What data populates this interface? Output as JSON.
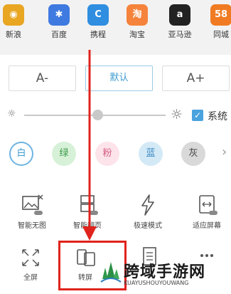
{
  "apps": [
    {
      "label": "新浪",
      "icon": "sina-icon",
      "glyph": "◉",
      "color": "#e8a623"
    },
    {
      "label": "百度",
      "icon": "baidu-icon",
      "glyph": "✱",
      "color": "#3e7ae0"
    },
    {
      "label": "携程",
      "icon": "ctrip-icon",
      "glyph": "C",
      "color": "#2f8ee0"
    },
    {
      "label": "淘宝",
      "icon": "taobao-icon",
      "glyph": "淘",
      "color": "#f5833c"
    },
    {
      "label": "亚马逊",
      "icon": "amazon-icon",
      "glyph": "a",
      "color": "#222222"
    },
    {
      "label": "同城",
      "icon": "tongcheng-icon",
      "glyph": "58",
      "color": "#f07b23"
    }
  ],
  "font_size": {
    "decrease_label": "A-",
    "default_label": "默认",
    "increase_label": "A+"
  },
  "brightness": {
    "level_percent": 52,
    "system_checkbox_label": "系统",
    "system_checked": true
  },
  "themes": [
    {
      "label": "白",
      "bg": "#ffffff",
      "fg": "#3b9bd1",
      "selected": true
    },
    {
      "label": "绿",
      "bg": "#d6f1d8",
      "fg": "#3d9a47",
      "selected": false
    },
    {
      "label": "粉",
      "bg": "#fde3ea",
      "fg": "#d45c80",
      "selected": false
    },
    {
      "label": "蓝",
      "bg": "#d3e9f6",
      "fg": "#3b88c1",
      "selected": false
    },
    {
      "label": "灰",
      "bg": "#d9d9d9",
      "fg": "#444444",
      "selected": false
    }
  ],
  "tools_row1": [
    {
      "label": "智能无图",
      "icon": "no-image-icon"
    },
    {
      "label": "智能翻页",
      "icon": "page-turn-icon"
    },
    {
      "label": "极速模式",
      "icon": "lightning-icon"
    },
    {
      "label": "适应屏幕",
      "icon": "fit-screen-icon"
    }
  ],
  "tools_row2": [
    {
      "label": "全屏",
      "icon": "fullscreen-icon"
    },
    {
      "label": "转屏",
      "icon": "rotate-screen-icon"
    },
    {
      "label": "",
      "icon": "reader-mode-icon"
    },
    {
      "label": "",
      "icon": "more-dots-icon"
    }
  ],
  "watermark": {
    "title": "跨域手游网",
    "subtitle": "KUAYUSHOUYOUWANG"
  },
  "colors": {
    "accent": "#3b9bd1",
    "highlight": "#e0231c"
  }
}
